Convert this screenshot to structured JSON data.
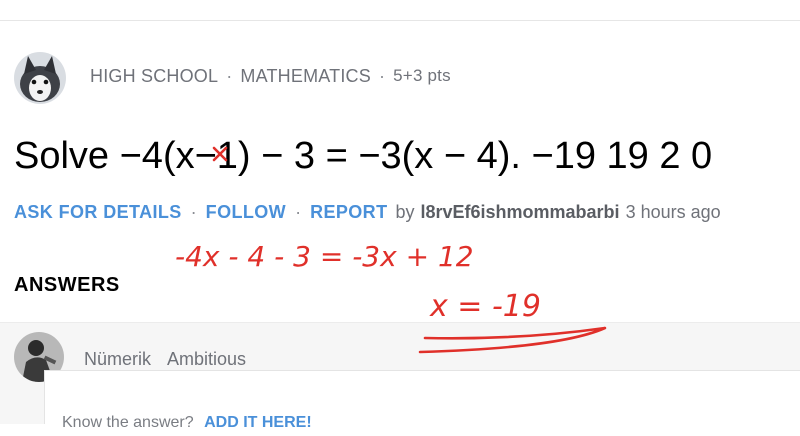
{
  "question_meta": {
    "level": "HIGH SCHOOL",
    "subject": "MATHEMATICS",
    "points": "5+3 pts"
  },
  "question": {
    "text": "Solve −4(x−1) − 3 = −3(x − 4). −19 19 2 0"
  },
  "actions": {
    "ask_details": "ASK FOR DETAILS",
    "follow": "FOLLOW",
    "report": "REPORT",
    "by": "by",
    "username": "l8rvEf6ishmommabarbi",
    "time": "3 hours ago"
  },
  "answers": {
    "heading": "ANSWERS",
    "answerer_name": "Nümerik",
    "answerer_rank": "Ambitious",
    "peek_text": "Know the answer?",
    "add_it_here": "ADD IT HERE!"
  },
  "annotation": {
    "line1": "-4x - 4 - 3 = -3x + 12",
    "line2": "x = -19",
    "color": "#e0302a"
  },
  "colors": {
    "link": "#4a90d9",
    "meta": "#6f7279",
    "ink": "#e0302a"
  }
}
